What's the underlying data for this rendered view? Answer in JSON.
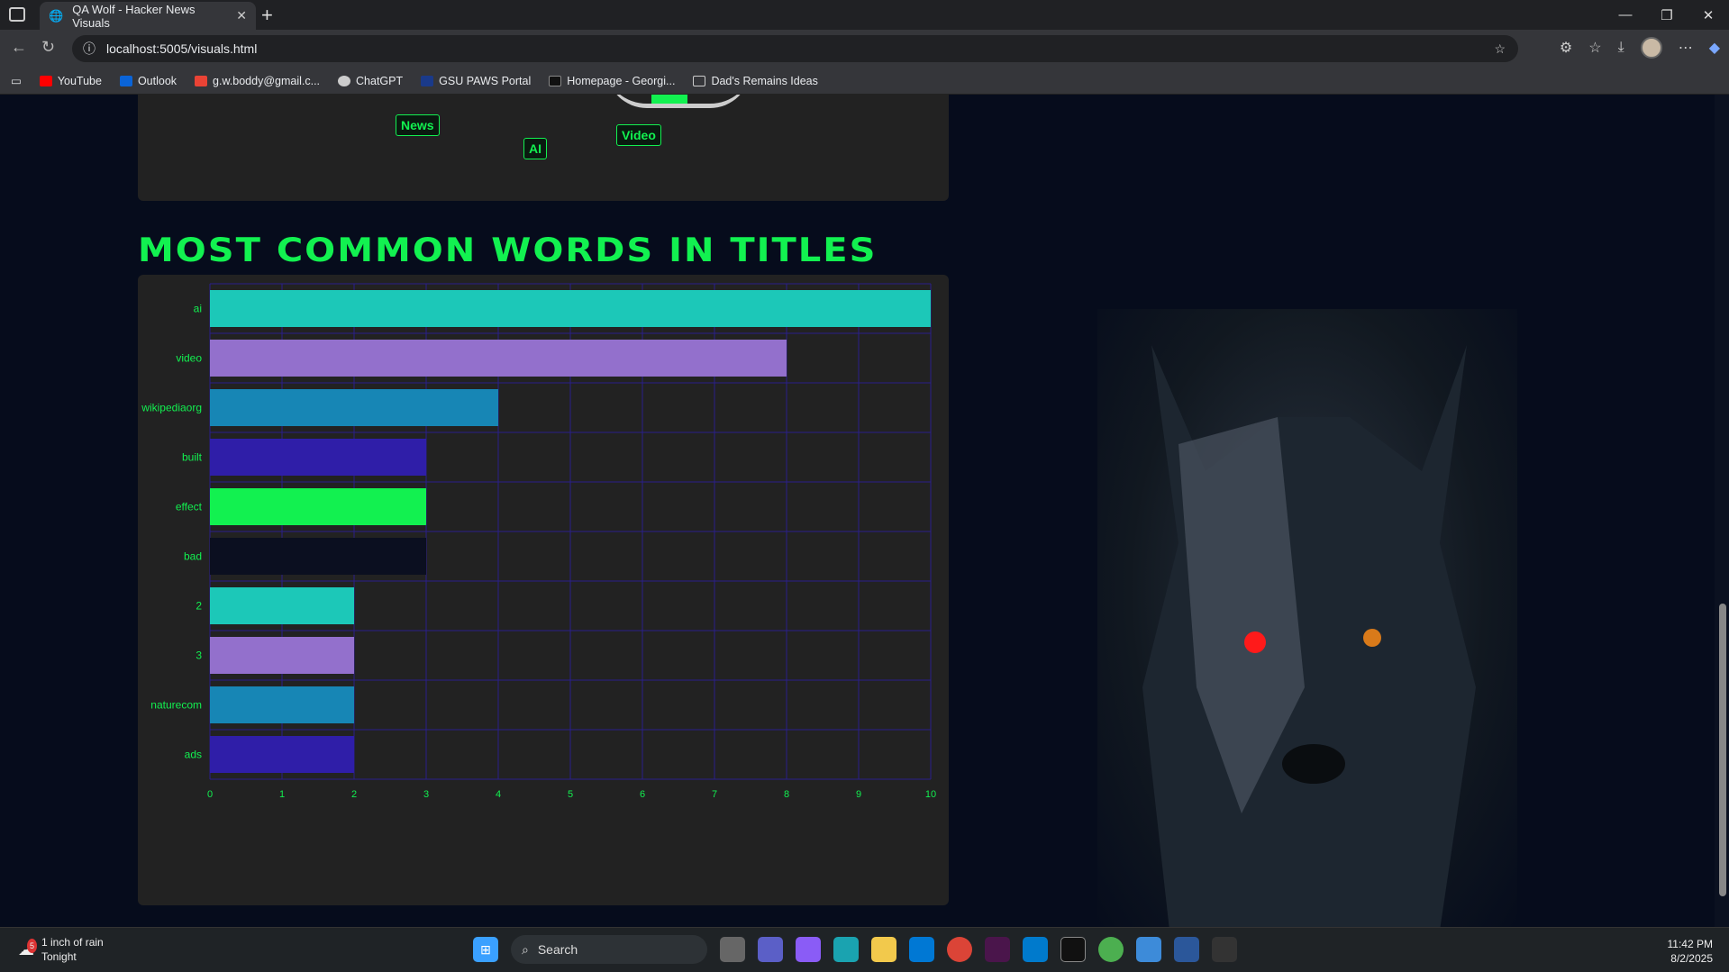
{
  "browser": {
    "tab_title": "QA Wolf - Hacker News Visuals",
    "url": "localhost:5005/visuals.html",
    "bookmarks": [
      "YouTube",
      "Outlook",
      "g.w.boddy@gmail.c...",
      "ChatGPT",
      "GSU PAWS Portal",
      "Homepage - Georgi...",
      "Dad's Remains Ideas"
    ]
  },
  "pie_labels": {
    "news": "News",
    "ai": "AI",
    "video": "Video"
  },
  "section": {
    "heading": "MOST COMMON WORDS IN TITLES"
  },
  "chart_data": {
    "type": "bar",
    "orientation": "horizontal",
    "categories": [
      "ai",
      "video",
      "wikipediaorg",
      "built",
      "effect",
      "bad",
      "2",
      "3",
      "naturecom",
      "ads"
    ],
    "values": [
      10,
      8,
      4,
      3,
      3,
      3,
      2,
      2,
      2,
      2
    ],
    "colors": [
      "#1cc8b8",
      "#9370cc",
      "#1786b5",
      "#2f1ea8",
      "#12f150",
      "#0b0f20",
      "#1cc8b8",
      "#9370cc",
      "#1786b5",
      "#2f1ea8"
    ],
    "xticks": [
      "0",
      "1",
      "2",
      "3",
      "4",
      "5",
      "6",
      "7",
      "8",
      "9",
      "10"
    ],
    "xlim": [
      0,
      10
    ],
    "grid": true,
    "title": "",
    "xlabel": "",
    "ylabel": ""
  },
  "taskbar": {
    "weather_line1": "1 inch of rain",
    "weather_line2": "Tonight",
    "weather_badge": "5",
    "search_placeholder": "Search",
    "time": "11:42 PM",
    "date": "8/2/2025"
  }
}
